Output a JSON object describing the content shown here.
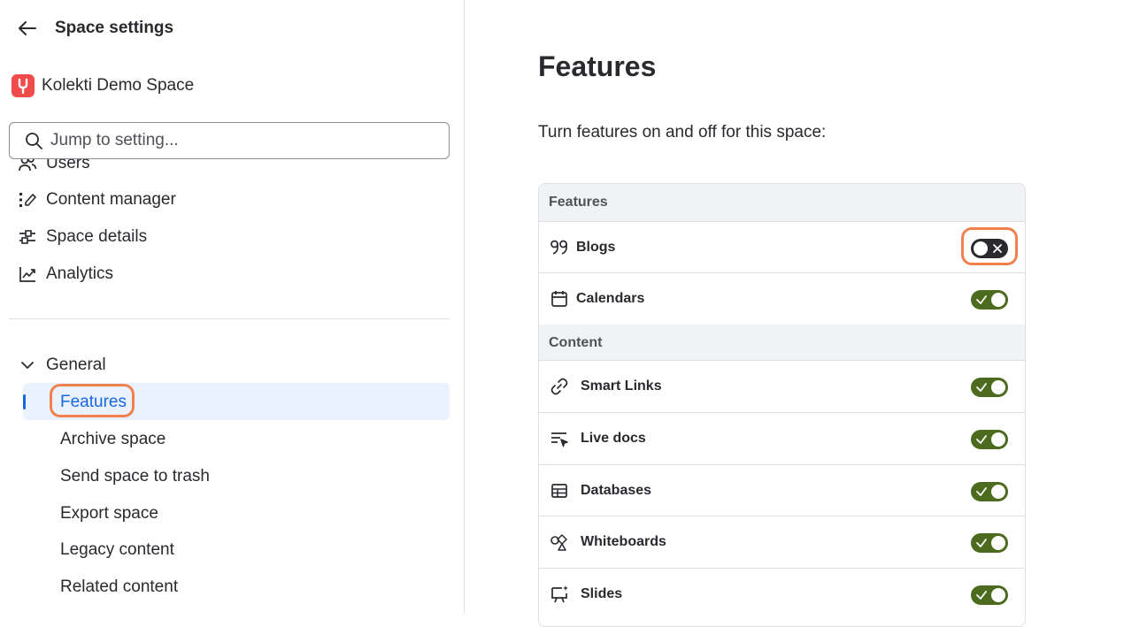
{
  "sidebar": {
    "title": "Space settings",
    "space_name": "Kolekti Demo Space",
    "search": {
      "placeholder": "Jump to setting...",
      "value": ""
    },
    "nav_items": [
      {
        "label": "Users",
        "icon": "users-icon"
      },
      {
        "label": "Content manager",
        "icon": "content-manager-icon"
      },
      {
        "label": "Space details",
        "icon": "sliders-icon"
      },
      {
        "label": "Analytics",
        "icon": "line-chart-icon"
      }
    ],
    "group": {
      "label": "General",
      "expanded": true
    },
    "sub_items": [
      {
        "label": "Features",
        "active": true
      },
      {
        "label": "Archive space"
      },
      {
        "label": "Send space to trash"
      },
      {
        "label": "Export space"
      },
      {
        "label": "Legacy content"
      },
      {
        "label": "Related content"
      }
    ]
  },
  "main": {
    "title": "Features",
    "description": "Turn features on and off for this space:",
    "sections": [
      {
        "header": "Features",
        "items": [
          {
            "label": "Blogs",
            "icon": "quote-icon",
            "enabled": false
          },
          {
            "label": "Calendars",
            "icon": "calendar-icon",
            "enabled": true
          }
        ]
      },
      {
        "header": "Content",
        "items": [
          {
            "label": "Smart Links",
            "icon": "link-icon",
            "enabled": true
          },
          {
            "label": "Live docs",
            "icon": "live-doc-icon",
            "enabled": true
          },
          {
            "label": "Databases",
            "icon": "database-icon",
            "enabled": true
          },
          {
            "label": "Whiteboards",
            "icon": "whiteboard-icon",
            "enabled": true
          },
          {
            "label": "Slides",
            "icon": "slides-icon",
            "enabled": true
          }
        ]
      }
    ]
  },
  "colors": {
    "accent": "#1868db",
    "toggle_on": "#4c6b1f",
    "toggle_off": "#292a2e",
    "highlight": "#f0804f",
    "logo": "#ef4b4b"
  }
}
